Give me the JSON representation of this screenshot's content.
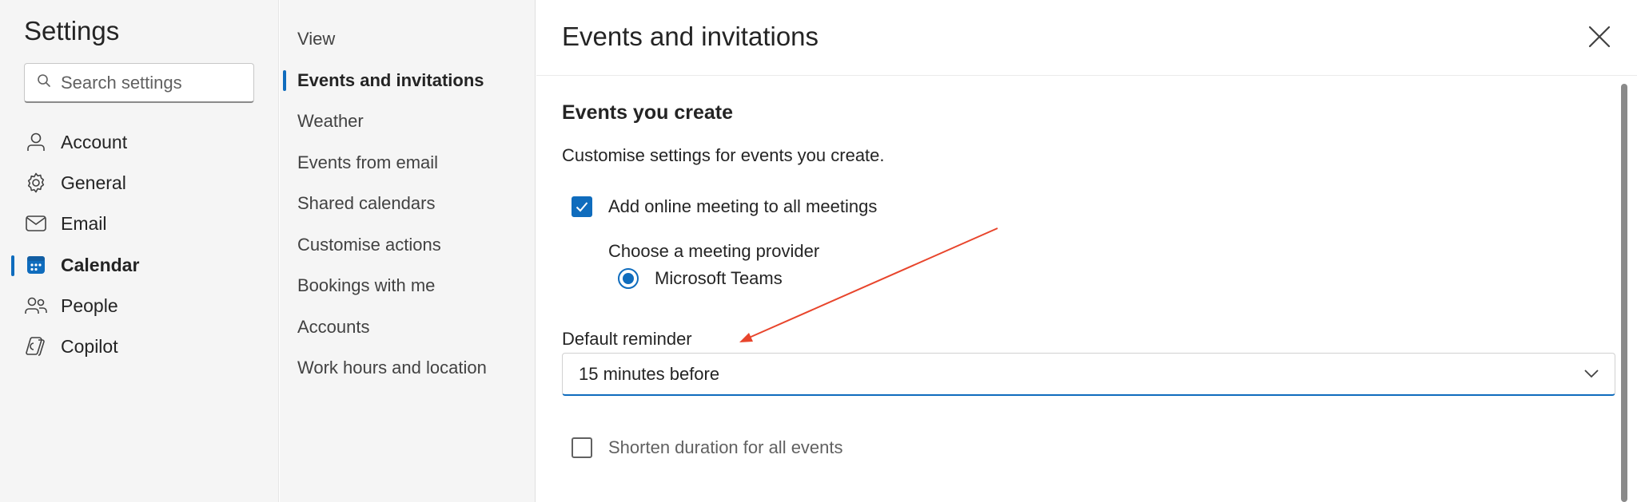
{
  "sidebar": {
    "title": "Settings",
    "search_placeholder": "Search settings",
    "items": [
      {
        "label": "Account",
        "icon": "person-icon"
      },
      {
        "label": "General",
        "icon": "gear-icon"
      },
      {
        "label": "Email",
        "icon": "mail-icon"
      },
      {
        "label": "Calendar",
        "icon": "calendar-icon",
        "active": true
      },
      {
        "label": "People",
        "icon": "people-icon"
      },
      {
        "label": "Copilot",
        "icon": "copilot-icon"
      }
    ]
  },
  "subnav": {
    "items": [
      {
        "label": "View"
      },
      {
        "label": "Events and invitations",
        "active": true
      },
      {
        "label": "Weather"
      },
      {
        "label": "Events from email"
      },
      {
        "label": "Shared calendars"
      },
      {
        "label": "Customise actions"
      },
      {
        "label": "Bookings with me"
      },
      {
        "label": "Accounts"
      },
      {
        "label": "Work hours and location"
      }
    ]
  },
  "panel": {
    "title": "Events and invitations",
    "section_title": "Events you create",
    "section_desc": "Customise settings for events you create.",
    "online_meeting_label": "Add online meeting to all meetings",
    "online_meeting_checked": true,
    "provider_label": "Choose a meeting provider",
    "provider_option": "Microsoft Teams",
    "reminder_label": "Default reminder",
    "reminder_value": "15 minutes before",
    "shorten_label": "Shorten duration for all events",
    "shorten_checked": false
  },
  "colors": {
    "accent": "#0f6cbd",
    "annotation_arrow": "#e8452c"
  }
}
